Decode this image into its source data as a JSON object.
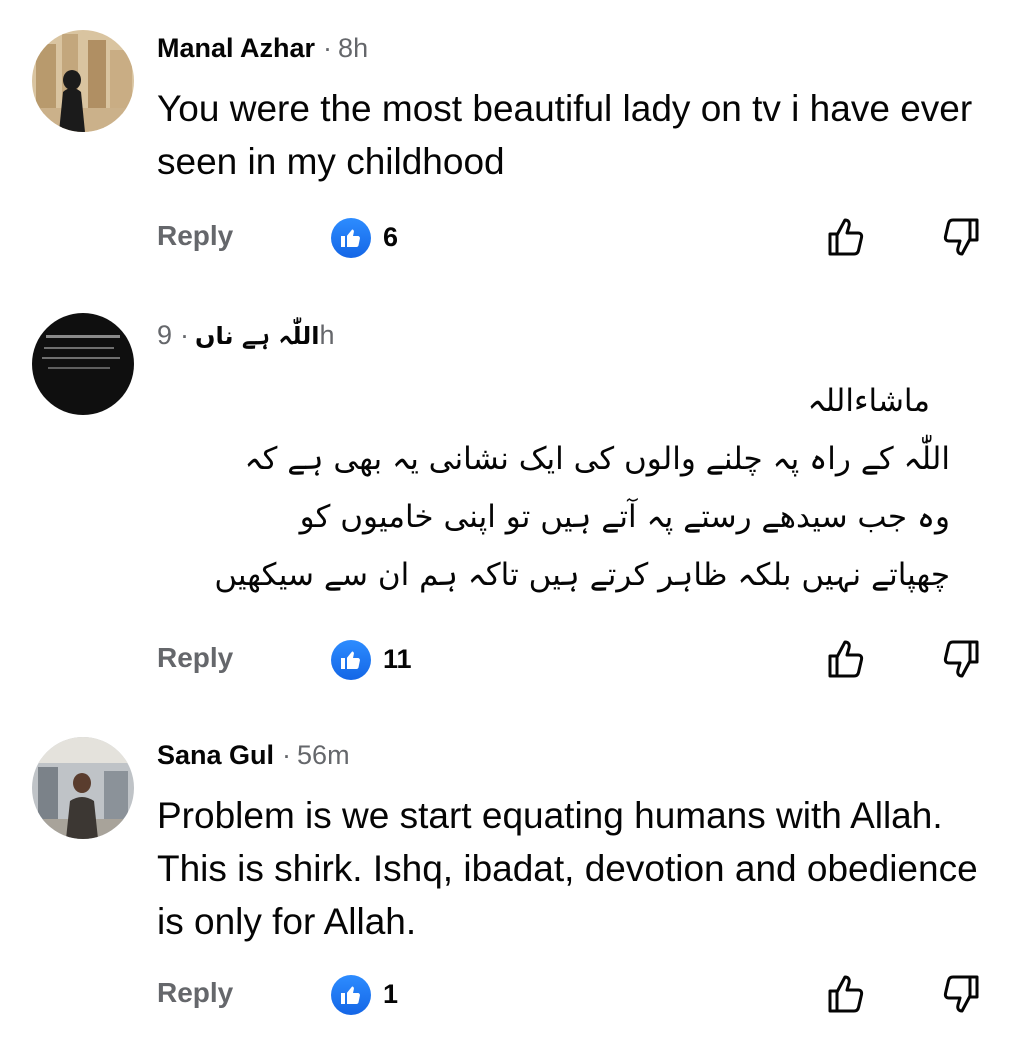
{
  "comments": [
    {
      "author": "Manal Azhar",
      "time": "8h",
      "text": "You were the most beautiful lady on tv i have ever seen in my childhood",
      "reply_label": "Reply",
      "like_count": "6"
    },
    {
      "author": "اللّٰہ ہے ناں",
      "time": "9h",
      "text_lines": [
        "ماشاءاللہ",
        "اللّٰہ کے راہ پہ چلنے والوں کی ایک نشانی یہ بھی ہے کہ",
        "وہ جب سیدھے رستے پہ آتے ہیں تو اپنی خامیوں کو",
        "چھپاتے نہیں بلکہ ظاہر کرتے ہیں تاکہ ہم ان سے سیکھیں"
      ],
      "reply_label": "Reply",
      "like_count": "11"
    },
    {
      "author": "Sana Gul",
      "time": "56m",
      "text": "Problem is we start equating humans with Allah. This is shirk. Ishq, ibadat, devotion and obedience is only for Allah.",
      "reply_label": "Reply",
      "like_count": "1"
    }
  ],
  "icons": {
    "like_badge": "thumbs-up-icon",
    "upvote": "thumbs-up-outline-icon",
    "downvote": "thumbs-down-outline-icon"
  },
  "colors": {
    "like_blue": "#1877f2",
    "secondary_text": "#65676b",
    "primary_text": "#050505"
  }
}
